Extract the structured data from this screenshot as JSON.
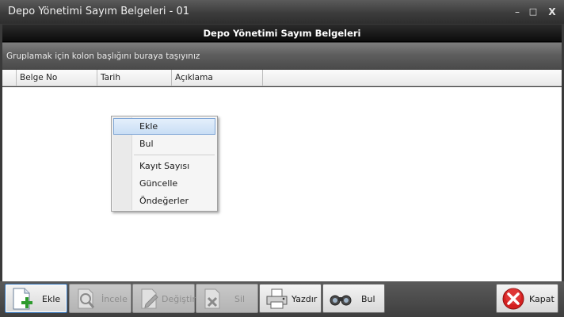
{
  "window": {
    "title": "Depo Yönetimi Sayım Belgeleri - 01",
    "controls": {
      "minimize": "–",
      "maximize": "□",
      "close": "X"
    }
  },
  "header": {
    "title": "Depo Yönetimi Sayım Belgeleri"
  },
  "group_panel": {
    "hint": "Gruplamak için kolon başlığını buraya taşıyınız"
  },
  "grid": {
    "columns": [
      "Belge No",
      "Tarih",
      "Açıklama"
    ],
    "rows": []
  },
  "context_menu": {
    "items": [
      {
        "label": "Ekle",
        "selected": true
      },
      {
        "label": "Bul"
      },
      {
        "label": "Kayıt Sayısı"
      },
      {
        "label": "Güncelle"
      },
      {
        "label": "Öndeğerler"
      }
    ]
  },
  "toolbar": {
    "buttons": [
      {
        "label": "Ekle",
        "icon": "add-document-icon",
        "enabled": true
      },
      {
        "label": "İncele",
        "icon": "magnifier-document-icon",
        "enabled": false
      },
      {
        "label": "Değiştir",
        "icon": "edit-document-icon",
        "enabled": false
      },
      {
        "label": "Sil",
        "icon": "delete-document-icon",
        "enabled": false
      },
      {
        "label": "Yazdır",
        "icon": "printer-icon",
        "enabled": true
      },
      {
        "label": "Bul",
        "icon": "binoculars-icon",
        "enabled": true
      },
      {
        "label": "Kapat",
        "icon": "close-circle-icon",
        "enabled": true
      }
    ]
  },
  "colors": {
    "accent": "#2f6fb5",
    "selection": "#c9def5",
    "close_red": "#d42020"
  }
}
